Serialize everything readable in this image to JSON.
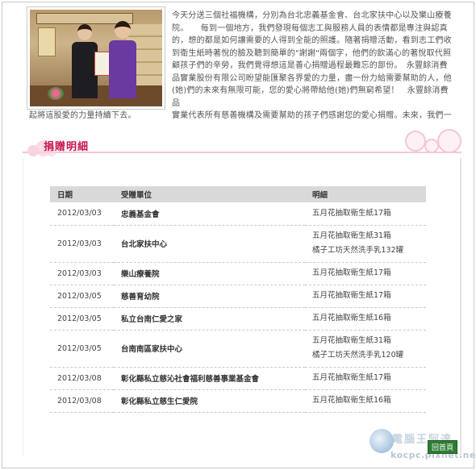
{
  "intro": {
    "lines": [
      "今天分送三個社福機構，分別為台北忠義基金會、台北家扶中心以及樂山療養",
      "院。　　每到一個地方，我們發現每個志工與服務人員的表情都是專注與認真",
      "的，想的都是如何讓需要的人得到全能的照護。隨著捐贈活動，看到志工們收",
      "到衛生紙時著悅的臉及聽到簡單的\"謝謝\"兩個字，他們的飲滿心的著悅取代照",
      "顧孩子們的辛勞，我們覺得想這是善心捐贈過程最難忘的部份。　永豐餘消費",
      "品實業股份有限公司盼望能匯聚各界愛的力量，盡一份力給需要幫助的人，他",
      "(她)們的未來有無限可能，您的愛心將帶給他(她)們無窮希望！　永豐餘消費品",
      "實業代表所有慈善機構及需要幫助的孩子們感謝您的愛心捐贈。未來，我們一"
    ],
    "tail": "起將這股愛的力量持續下去。"
  },
  "section": {
    "title": "捐贈明細"
  },
  "table": {
    "headers": [
      "日期",
      "受贈單位",
      "明細"
    ],
    "rows": [
      {
        "date": "2012/03/03",
        "unit": "忠義基金會",
        "items": [
          "五月花抽取衛生紙17箱"
        ]
      },
      {
        "date": "2012/03/03",
        "unit": "台北家扶中心",
        "items": [
          "五月花抽取衛生紙31箱",
          "橘子工坊天然洗手乳132罐"
        ]
      },
      {
        "date": "2012/03/03",
        "unit": "樂山療養院",
        "items": [
          "五月花抽取衛生紙17箱"
        ]
      },
      {
        "date": "2012/03/05",
        "unit": "慈善育幼院",
        "items": [
          "五月花抽取衛生紙17箱"
        ]
      },
      {
        "date": "2012/03/05",
        "unit": "私立台南仁愛之家",
        "items": [
          "五月花抽取衛生紙16箱"
        ]
      },
      {
        "date": "2012/03/05",
        "unit": "台南南區家扶中心",
        "items": [
          "五月花抽取衛生紙31箱",
          "橘子工坊天然洗手乳120罐"
        ]
      },
      {
        "date": "2012/03/08",
        "unit": "彰化縣私立慈沁社會福利慈善事業基金會",
        "items": [
          "五月花抽取衛生紙17箱"
        ]
      },
      {
        "date": "2012/03/08",
        "unit": "彰化縣私立慈生仁愛院",
        "items": [
          "五月花抽取衛生紙16箱"
        ]
      }
    ]
  },
  "watermark": {
    "site_name": "電腦王阿達",
    "url": "kocpc.pixnet.net",
    "home_button": "回首頁"
  },
  "colors": {
    "accent": "#c8164c",
    "header_bg": "#d9d9d9",
    "pink_soft": "#f2c9d5"
  }
}
